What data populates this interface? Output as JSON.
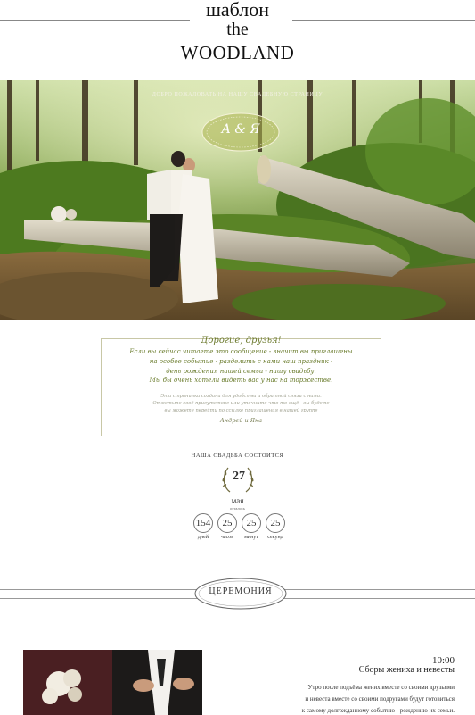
{
  "header": {
    "title_line1": "шаблон",
    "title_line2": "the",
    "title_line3": "WOODLAND"
  },
  "hero": {
    "caption": "ДОБРО ПОЖАЛОВАТЬ НА НАШУ СВАДЕБНУЮ СТРАНИЦУ",
    "monogram": "А & Я"
  },
  "invitation": {
    "greeting": "Дорогие, друзья!",
    "main_lines": [
      "Если вы сейчас читаете это сообщение - значит вы приглашены",
      "на особое событие - разделить с нами наш праздник -",
      "день рождения нашей семьи - нашу свадьбу.",
      "Мы бы очень хотели видеть вас у нас на торжестве."
    ],
    "small_lines": [
      "Эта страничка создана для удобства и обратной связи с нами.",
      "Отметьте своё присутствие или уточните что-то ещё - вы будете",
      "вы можете перейти по ссылке приглашения в нашей группе"
    ],
    "signature": "Андрей и Яна"
  },
  "countdown": {
    "title": "НАША СВАДЬБА СОСТОИТСЯ",
    "day": "27",
    "month": "мая",
    "month_sub": "осталось",
    "units": [
      {
        "value": "154",
        "label": "дней"
      },
      {
        "value": "25",
        "label": "часов"
      },
      {
        "value": "25",
        "label": "минут"
      },
      {
        "value": "25",
        "label": "секунд"
      }
    ]
  },
  "ceremony": {
    "badge": "ЦЕРЕМОНИЯ"
  },
  "event": {
    "time": "10:00",
    "title": "Сборы жениха и невесты",
    "desc_lines": [
      "Утро после подъёма жених вместе со своими друзьями",
      "и невеста вместе со своими подругами будут готовиться",
      "к самому долгожданному событию - рождению их семьи."
    ]
  },
  "colors": {
    "accent_olive": "#6c7a2e",
    "card_border": "#c8c7a6",
    "forest": "#3d5a1e"
  }
}
